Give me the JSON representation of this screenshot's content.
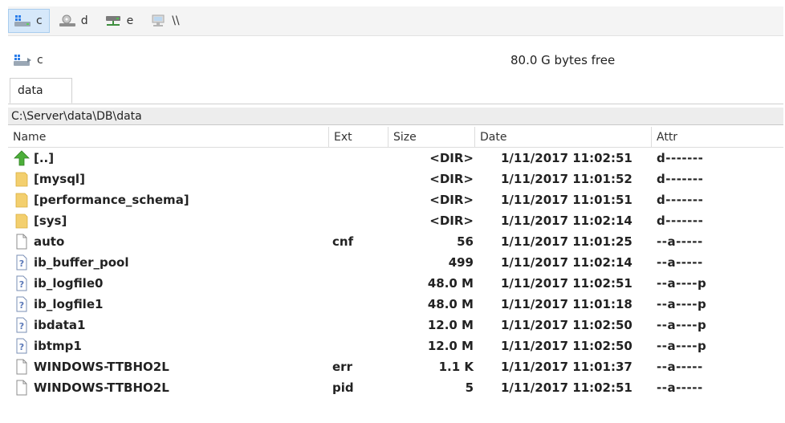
{
  "drives": [
    {
      "label": "c",
      "icon": "windows-drive-icon",
      "active": true
    },
    {
      "label": "d",
      "icon": "optical-drive-icon",
      "active": false
    },
    {
      "label": "e",
      "icon": "network-drive-icon",
      "active": false
    },
    {
      "label": "\\\\",
      "icon": "network-computer-icon",
      "active": false
    }
  ],
  "current_drive": {
    "label": "c",
    "free_space": "80.0 G bytes free"
  },
  "tab": {
    "label": "data"
  },
  "path": "C:\\Server\\data\\DB\\data",
  "columns": {
    "name": "Name",
    "ext": "Ext",
    "size": "Size",
    "date": "Date",
    "attr": "Attr"
  },
  "files": [
    {
      "icon": "parent-up-arrow-icon",
      "name": "[..]",
      "ext": "",
      "size": "<DIR>",
      "date": "1/11/2017 11:02:51",
      "attr": "d-------"
    },
    {
      "icon": "folder-icon",
      "name": "[mysql]",
      "ext": "",
      "size": "<DIR>",
      "date": "1/11/2017 11:01:52",
      "attr": "d-------"
    },
    {
      "icon": "folder-icon",
      "name": "[performance_schema]",
      "ext": "",
      "size": "<DIR>",
      "date": "1/11/2017 11:01:51",
      "attr": "d-------"
    },
    {
      "icon": "folder-icon",
      "name": "[sys]",
      "ext": "",
      "size": "<DIR>",
      "date": "1/11/2017 11:02:14",
      "attr": "d-------"
    },
    {
      "icon": "file-icon",
      "name": "auto",
      "ext": "cnf",
      "size": "56",
      "date": "1/11/2017 11:01:25",
      "attr": "--a-----"
    },
    {
      "icon": "unknown-file-icon",
      "name": "ib_buffer_pool",
      "ext": "",
      "size": "499",
      "date": "1/11/2017 11:02:14",
      "attr": "--a-----"
    },
    {
      "icon": "unknown-file-icon",
      "name": "ib_logfile0",
      "ext": "",
      "size": "48.0 M",
      "date": "1/11/2017 11:02:51",
      "attr": "--a----p"
    },
    {
      "icon": "unknown-file-icon",
      "name": "ib_logfile1",
      "ext": "",
      "size": "48.0 M",
      "date": "1/11/2017 11:01:18",
      "attr": "--a----p"
    },
    {
      "icon": "unknown-file-icon",
      "name": "ibdata1",
      "ext": "",
      "size": "12.0 M",
      "date": "1/11/2017 11:02:50",
      "attr": "--a----p"
    },
    {
      "icon": "unknown-file-icon",
      "name": "ibtmp1",
      "ext": "",
      "size": "12.0 M",
      "date": "1/11/2017 11:02:50",
      "attr": "--a----p"
    },
    {
      "icon": "file-icon",
      "name": "WINDOWS-TTBHO2L",
      "ext": "err",
      "size": "1.1 K",
      "date": "1/11/2017 11:01:37",
      "attr": "--a-----"
    },
    {
      "icon": "file-icon",
      "name": "WINDOWS-TTBHO2L",
      "ext": "pid",
      "size": "5",
      "date": "1/11/2017 11:02:51",
      "attr": "--a-----"
    }
  ],
  "colors": {
    "folder": "#f3cf6e",
    "up_arrow": "#4caf3a",
    "active_drive_bg": "#d6e8fa"
  }
}
